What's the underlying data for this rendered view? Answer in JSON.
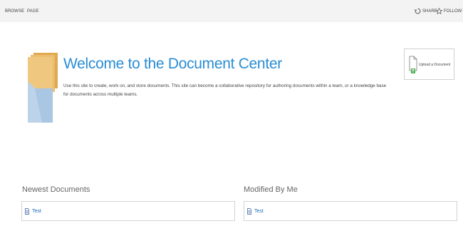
{
  "ribbon": {
    "tabs": [
      {
        "label": "BROWSE"
      },
      {
        "label": "PAGE"
      }
    ],
    "actions": {
      "share_label": "SHARE",
      "follow_label": "FOLLOW"
    }
  },
  "welcome": {
    "title": "Welcome to the Document Center",
    "description": "Use this site to create, work on, and store documents. This site can become a collaborative repository for authoring documents within a team, or a knowledge base for documents across multiple teams."
  },
  "upload": {
    "label": "Upload a Document"
  },
  "sections": {
    "newest": {
      "title": "Newest Documents",
      "items": [
        {
          "name": "Test"
        }
      ]
    },
    "modified": {
      "title": "Modified By Me",
      "items": [
        {
          "name": "Test"
        }
      ]
    }
  },
  "colors": {
    "accent": "#2a8dd4",
    "link": "#1a6fb8",
    "logo_yellow": "#efc77f",
    "logo_blue": "#bcd3ea"
  }
}
